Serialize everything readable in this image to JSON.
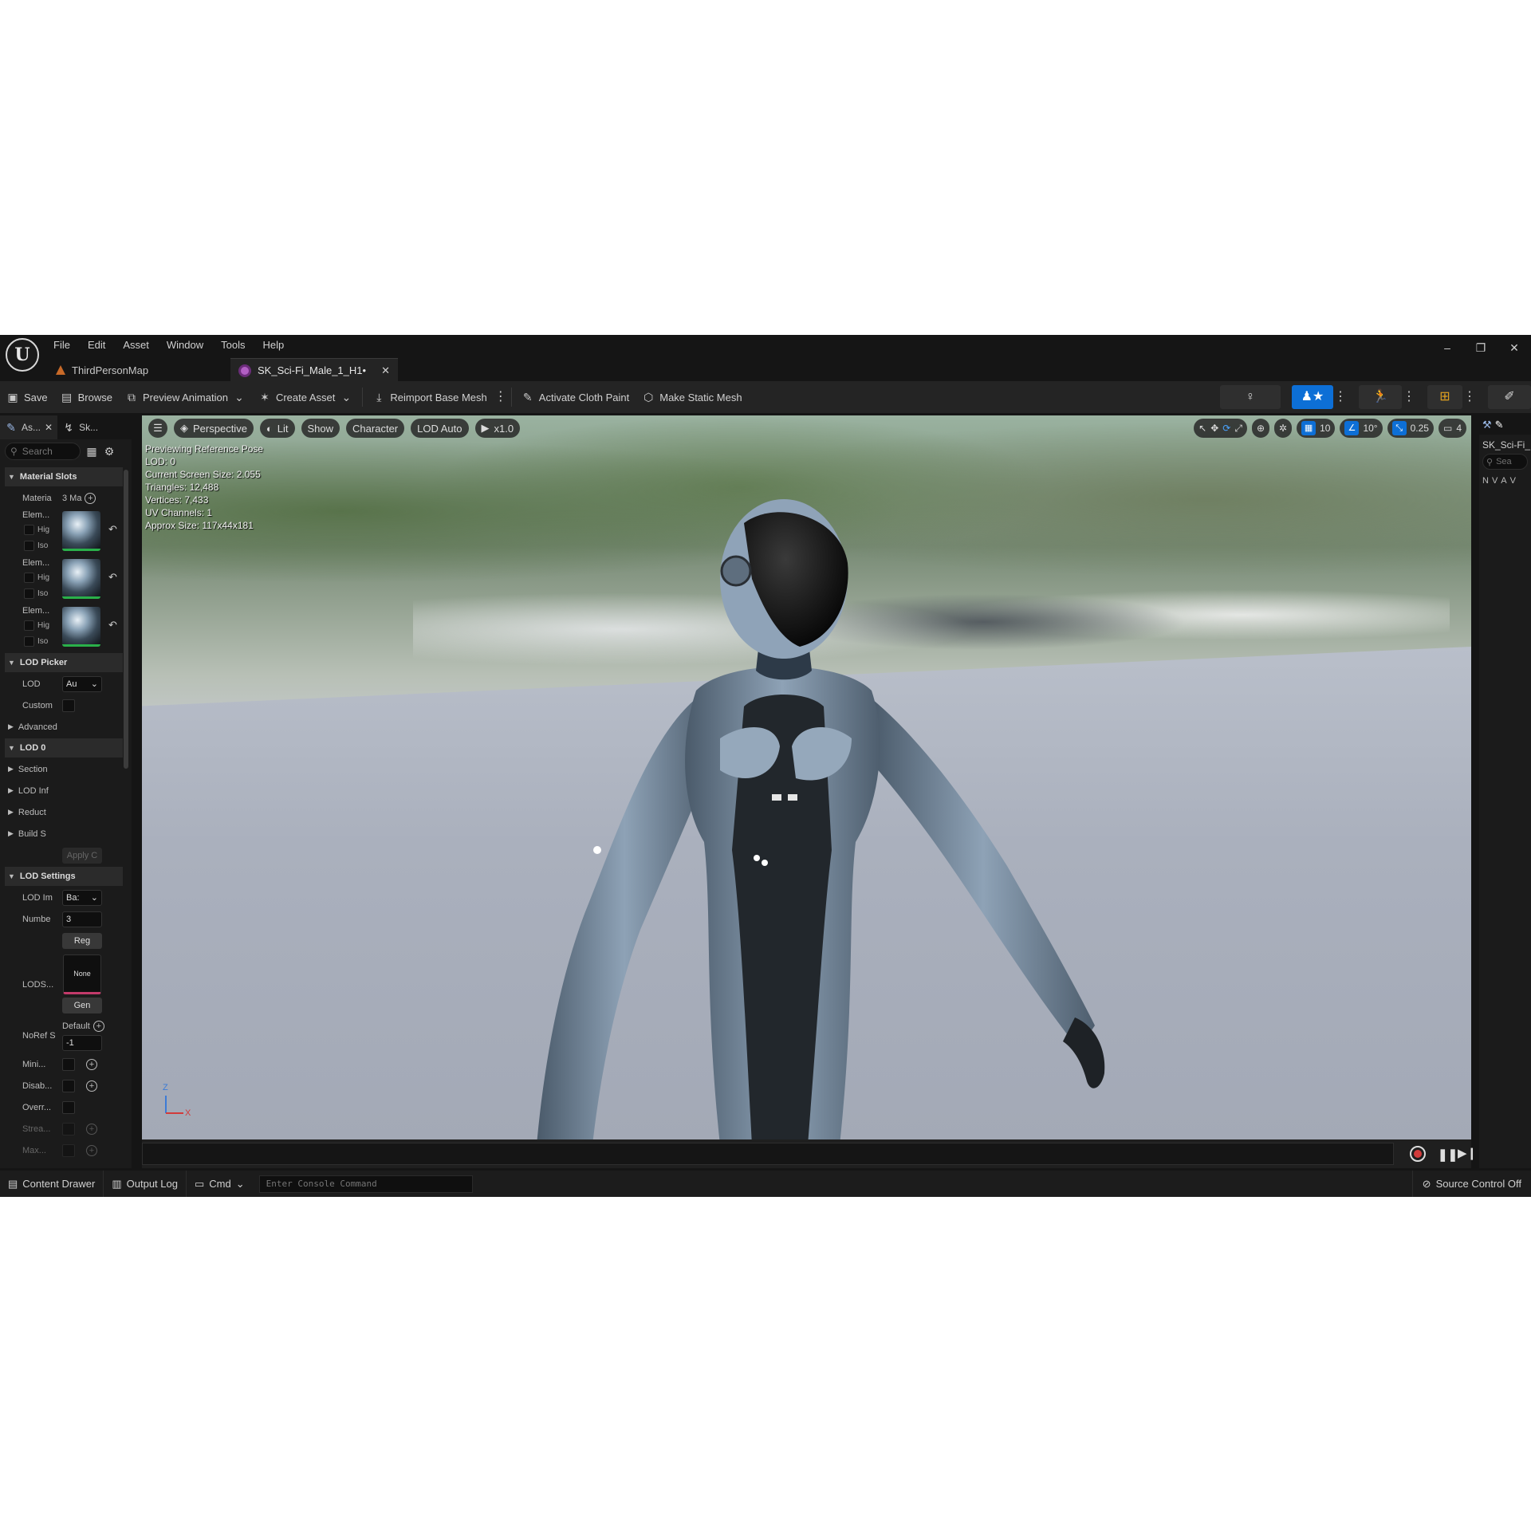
{
  "menu": [
    "File",
    "Edit",
    "Asset",
    "Window",
    "Tools",
    "Help"
  ],
  "window_controls": {
    "minimize": "–",
    "restore": "❐",
    "close": "✕"
  },
  "tabs": [
    {
      "label": "ThirdPersonMap",
      "icon": "map-icon",
      "active": false
    },
    {
      "label": "SK_Sci-Fi_Male_1_H1•",
      "icon": "skeletal-mesh-icon",
      "active": true
    }
  ],
  "toolbar": {
    "save": "Save",
    "browse": "Browse",
    "preview_animation": "Preview Animation",
    "create_asset": "Create Asset",
    "reimport": "Reimport Base Mesh",
    "cloth_paint": "Activate Cloth Paint",
    "make_static": "Make Static Mesh"
  },
  "left_panel": {
    "tabs": [
      "As...",
      "Sk..."
    ],
    "search_placeholder": "Search",
    "sections": {
      "material_slots": "Material Slots",
      "materials_label": "Materia",
      "materials_count": "3 Ma",
      "elements": [
        {
          "label": "Elem...",
          "highlight": "Hig",
          "isolate": "Iso"
        },
        {
          "label": "Elem...",
          "highlight": "Hig",
          "isolate": "Iso"
        },
        {
          "label": "Elem...",
          "highlight": "Hig",
          "isolate": "Iso"
        }
      ],
      "lod_picker": "LOD Picker",
      "lod_label": "LOD",
      "lod_value": "Au",
      "custom_label": "Custom",
      "advanced": "Advanced",
      "lod0": "LOD 0",
      "lod0_rows": [
        "Section",
        "LOD Inf",
        "Reduct",
        "Build S"
      ],
      "apply": "Apply C",
      "lod_settings": "LOD Settings",
      "lod_import_label": "LOD Im",
      "lod_import_value": "Ba:",
      "number_label": "Numbe",
      "number_value": "3",
      "regen_button": "Reg",
      "lods_label": "LODS...",
      "none_text": "None",
      "gen_button": "Gen",
      "noref_label": "NoRef S",
      "noref_default": "Default",
      "noref_value": "-1",
      "mini_label": "Mini...",
      "disab_label": "Disab...",
      "overr_label": "Overr...",
      "strea_label": "Strea...",
      "max_label": "Max..."
    }
  },
  "viewport": {
    "perspective": "Perspective",
    "lit": "Lit",
    "show": "Show",
    "character": "Character",
    "lod_auto": "LOD Auto",
    "speed": "x1.0",
    "grid_snap": "10",
    "rot_snap": "10°",
    "scale_snap": "0.25",
    "camera_speed": "4",
    "info": [
      "Previewing Reference Pose",
      "LOD: 0",
      "Current Screen Size: 2.055",
      "Triangles: 12,488",
      "Vertices: 7,433",
      "UV Channels: 1",
      "Approx Size: 117x44x181"
    ],
    "axis_z": "Z",
    "axis_x": "X"
  },
  "right_panel": {
    "title": "SK_Sci-Fi_",
    "search_placeholder": "Sea",
    "letters": [
      "N",
      "V",
      "A",
      "V"
    ]
  },
  "statusbar": {
    "content_drawer": "Content Drawer",
    "output_log": "Output Log",
    "cmd": "Cmd",
    "console_placeholder": "Enter Console Command",
    "source_control": "Source Control Off"
  },
  "colors": {
    "accent_blue": "#0d6fd6",
    "material_ok_green": "#2ab04a",
    "lod_pink": "#c23a6a",
    "record_red": "#d23a3a"
  }
}
